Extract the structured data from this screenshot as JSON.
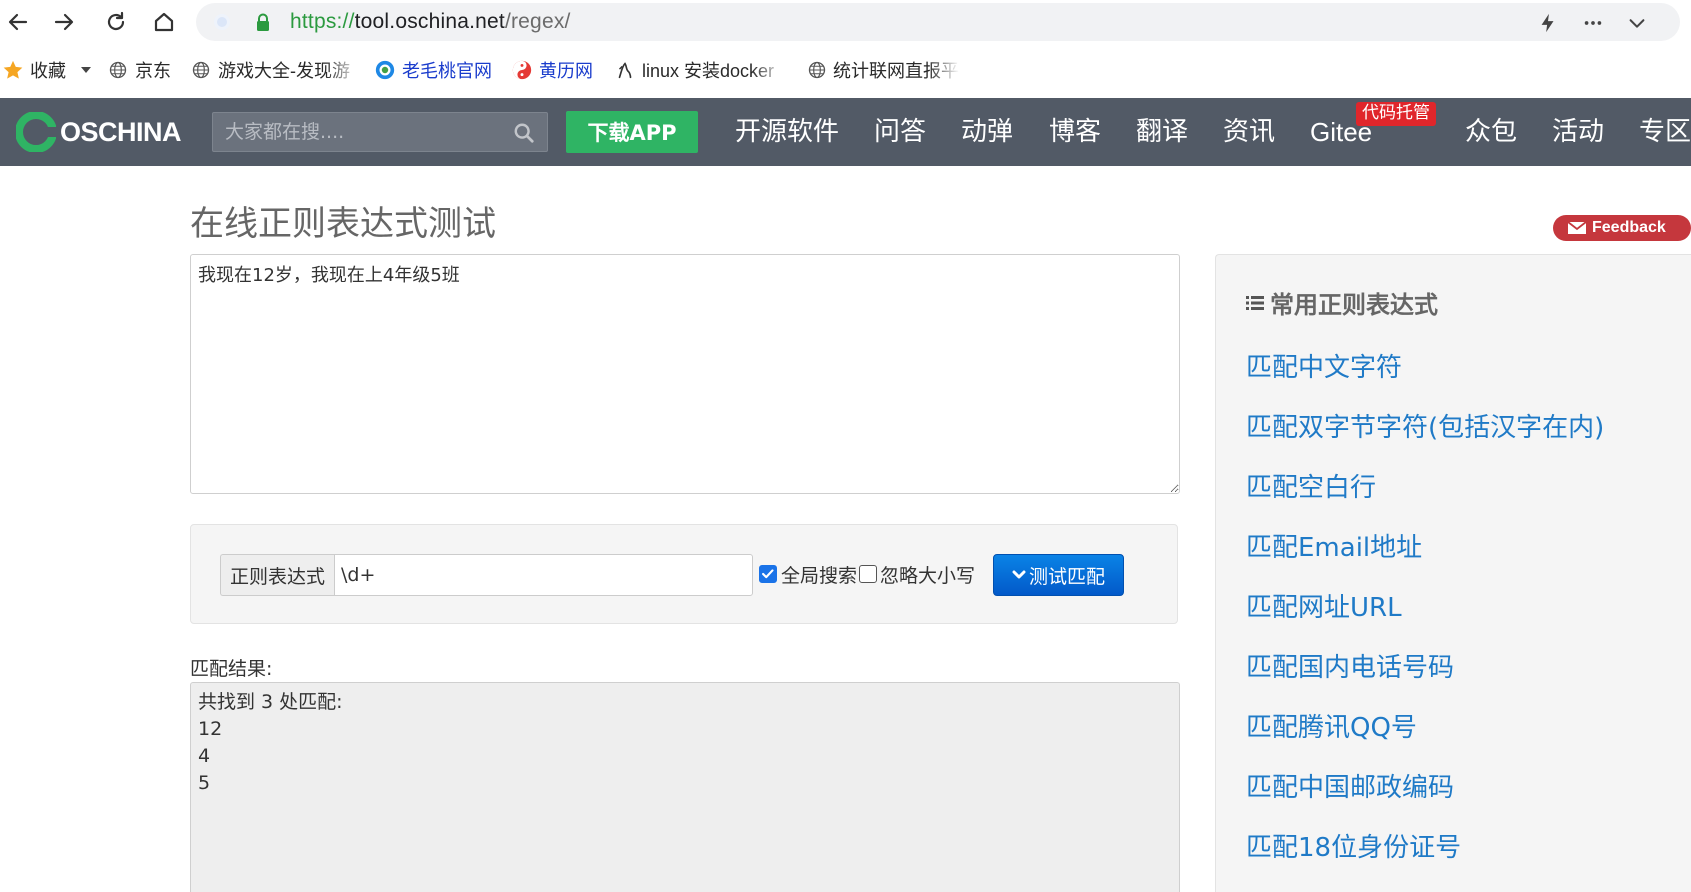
{
  "browser": {
    "url": {
      "scheme": "https://",
      "host": "tool.oschina.net",
      "path": "/regex/"
    }
  },
  "bookmarks": [
    {
      "label": "收藏",
      "icon": "star-icon"
    },
    {
      "label": "京东",
      "icon": "globe-icon"
    },
    {
      "label": "游戏大全-发现游",
      "icon": "globe-icon"
    },
    {
      "label": "老毛桃官网",
      "icon": "laomaotao-icon"
    },
    {
      "label": "黄历网",
      "icon": "huangli-icon"
    },
    {
      "label": "linux 安装docker",
      "icon": "tux-icon"
    },
    {
      "label": "统计联网直报平",
      "icon": "globe-icon"
    }
  ],
  "site_nav": {
    "logo_text": "OSCHINA",
    "search_placeholder": "大家都在搜....",
    "download_label": "下载APP",
    "items": [
      "开源软件",
      "问答",
      "动弹",
      "博客",
      "翻译",
      "资讯",
      "Gitee",
      "众包",
      "活动",
      "专区"
    ],
    "gitee_badge": "代码托管"
  },
  "page": {
    "title": "在线正则表达式测试",
    "feedback_label": "Feedback",
    "input_text": "我现在12岁，我现在上4年级5班",
    "regex_addon_label": "正则表达式",
    "regex_value": "\\d+",
    "global_search_label": "全局搜索",
    "global_search_checked": true,
    "ignore_case_label": "忽略大小写",
    "ignore_case_checked": false,
    "test_button_label": "测试匹配",
    "result_label": "匹配结果:",
    "result_summary": "共找到 3 处匹配:",
    "matches": [
      "12",
      "4",
      "5"
    ]
  },
  "sidebar": {
    "title": "常用正则表达式",
    "links": [
      "匹配中文字符",
      "匹配双字节字符(包括汉字在内)",
      "匹配空白行",
      "匹配Email地址",
      "匹配网址URL",
      "匹配国内电话号码",
      "匹配腾讯QQ号",
      "匹配中国邮政编码",
      "匹配18位身份证号"
    ]
  },
  "colors": {
    "nav_bg": "#525a66",
    "download_green": "#2fb464",
    "link_blue": "#1f7ac7",
    "feedback_red": "#c5373d",
    "badge_red": "#e0262b",
    "button_blue": "#0a6fe0"
  }
}
